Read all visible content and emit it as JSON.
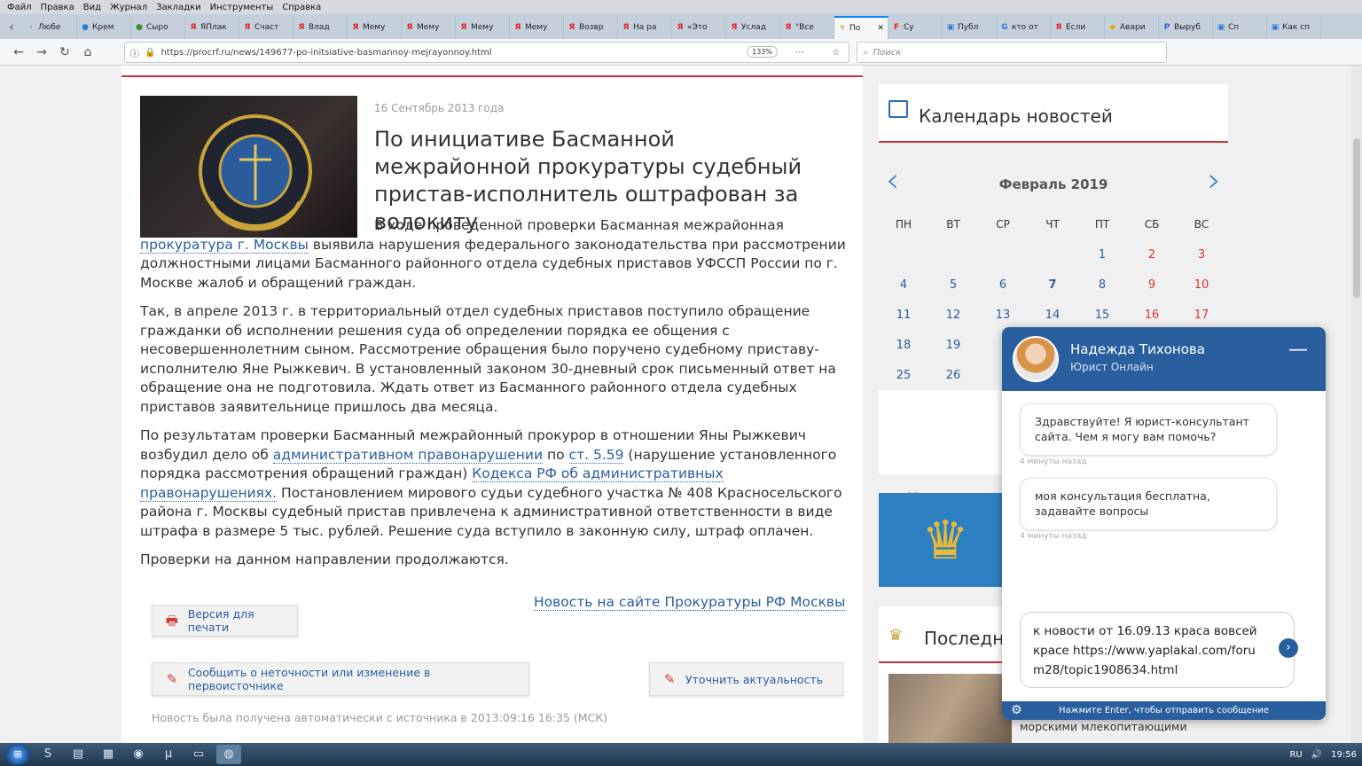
{
  "menubar": [
    "Файл",
    "Правка",
    "Вид",
    "Журнал",
    "Закладки",
    "Инструменты",
    "Справка"
  ],
  "tabs": [
    {
      "label": "Любе",
      "icon": "·"
    },
    {
      "label": "Крем",
      "icon": "●"
    },
    {
      "label": "Сыро",
      "icon": "●"
    },
    {
      "label": "ЯПлак",
      "icon": "Я"
    },
    {
      "label": "Счаст",
      "icon": "Я"
    },
    {
      "label": "Влад",
      "icon": "Я"
    },
    {
      "label": "Мему",
      "icon": "Я"
    },
    {
      "label": "Мему",
      "icon": "Я"
    },
    {
      "label": "Мему",
      "icon": "Я"
    },
    {
      "label": "Мему",
      "icon": "Я"
    },
    {
      "label": "Возвр",
      "icon": "Я"
    },
    {
      "label": "На ра",
      "icon": "Я"
    },
    {
      "label": "«Это",
      "icon": "Я"
    },
    {
      "label": "Услад",
      "icon": "Я"
    },
    {
      "label": "\"Все",
      "icon": "Я"
    },
    {
      "label": "По",
      "icon": "⚜"
    },
    {
      "label": "Су",
      "icon": "F"
    },
    {
      "label": "Публ",
      "icon": "▣"
    },
    {
      "label": "кто от",
      "icon": "G"
    },
    {
      "label": "Если",
      "icon": "Я"
    },
    {
      "label": "Авари",
      "icon": "◆"
    },
    {
      "label": "Выруб",
      "icon": "P"
    },
    {
      "label": "Сп",
      "icon": "▣"
    },
    {
      "label": "Как сп",
      "icon": "▣"
    }
  ],
  "url": "https://procrf.ru/news/149677-po-initsiative-basmannoy-mejrayonnoy.html",
  "zoom": "133%",
  "search_placeholder": "Поиск",
  "article": {
    "date": "16 Сентябрь 2013 года",
    "title": "По инициативе Басманной межрайонной прокуратуры судебный пристав-исполнитель оштрафован за волокиту",
    "p1_a": "В ходе проведенной проверки Басманная межрайонная ",
    "p1_link": "прокуратура г. Москвы",
    "p1_b": " выявила нарушения федерального законодательства при рассмотрении должностными лицами Басманного районного отдела судебных приставов УФССП России по г. Москве жалоб и обращений граждан.",
    "p2": "Так, в апреле 2013 г. в территориальный отдел судебных приставов поступило обращение гражданки об исполнении решения суда об определении порядка ее общения с несовершеннолетним сыном. Рассмотрение обращения было поручено судебному приставу-исполнителю Яне Рыжкевич. В установленный законом 30-дневный срок письменный ответ на обращение она не подготовила. Ждать ответ из Басманного районного отдела судебных приставов заявительнице пришлось два месяца.",
    "p3_a": "По результатам проверки Басманный межрайонный прокурор в отношении Яны Рыжкевич возбудил дело об ",
    "p3_link1": "административном правонарушении",
    "p3_b": " по ",
    "p3_link2": "ст. 5.59",
    "p3_c": " (нарушение установленного порядка рассмотрения обращений граждан) ",
    "p3_link3": "Кодекса РФ об административных правонарушениях.",
    "p3_d": " Постановлением мирового судьи судебного участка № 408 Красносельского района г. Москвы судебный пристав привлечена к административной ответственности в виде штрафа в размере 5 тыс. рублей. Решение суда вступило в законную силу, штраф оплачен.",
    "p4": "Проверки на данном направлении продолжаются.",
    "source_link": "Новость на сайте Прокуратуры РФ Москвы",
    "print_btn": "Версия для печати",
    "report_btn": "Сообщить о неточности или изменение в первоисточнике",
    "update_btn": "Уточнить актуальность",
    "footnote": "Новость была получена автоматически с источника в 2013:09:16 16:35 (МСК)"
  },
  "calendar": {
    "title": "Календарь новостей",
    "month": "Февраль 2019",
    "weekdays": [
      "ПН",
      "ВТ",
      "СР",
      "ЧТ",
      "ПТ",
      "СБ",
      "ВС"
    ],
    "weeks": [
      [
        "",
        "",
        "",
        "",
        "1",
        "2",
        "3"
      ],
      [
        "4",
        "5",
        "6",
        "7",
        "8",
        "9",
        "10"
      ],
      [
        "11",
        "12",
        "13",
        "14",
        "15",
        "16",
        "17"
      ],
      [
        "18",
        "19",
        "",
        "",
        "",
        "",
        ""
      ],
      [
        "25",
        "26",
        "",
        "",
        "",
        "",
        ""
      ]
    ],
    "today": "7",
    "news_for": "Новости за"
  },
  "latest": {
    "title": "Последние",
    "caption": "морскими млекопитающими"
  },
  "chat": {
    "name": "Надежда Тихонова",
    "role": "Юрист Онлайн",
    "msg1": "Здравствуйте! Я юрист-консультант сайта. Чем я могу вам помочь?",
    "msg2": "моя консультация бесплатна, задавайте вопросы",
    "time1": "4 минуты назад",
    "time2": "4 минуты назад",
    "input": "к новости от 16.09.13 краса вовсей красе https://www.yaplakal.com/forum28/topic1908634.html",
    "footer": "Нажмите Enter, чтобы отправить сообщение"
  },
  "taskbar": {
    "lang": "RU",
    "time": "19:56"
  }
}
